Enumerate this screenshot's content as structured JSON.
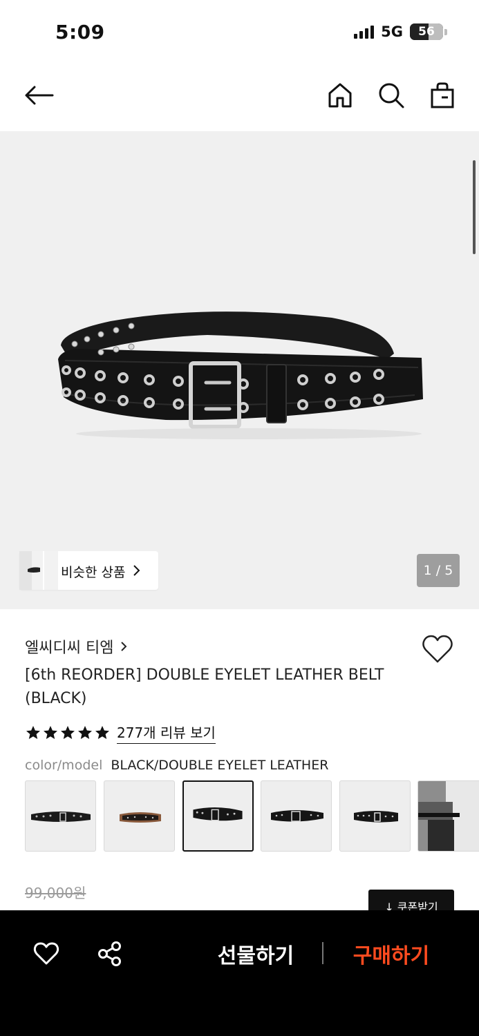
{
  "status_bar": {
    "time": "5:09",
    "network": "5G",
    "battery_percent": "56"
  },
  "nav": {
    "back_icon": "arrow-left-icon",
    "home_icon": "home-icon",
    "search_icon": "search-icon",
    "cart_icon": "shopping-bag-icon"
  },
  "gallery": {
    "similar_label": "비슷한 상품",
    "page_indicator": "1 / 5"
  },
  "product": {
    "brand": "엘씨디씨 티엠",
    "title": "[6th REORDER] DOUBLE EYELET LEATHER BELT (BLACK)",
    "rating_stars": 5,
    "review_link": "277개 리뷰 보기",
    "option_label": "color/model",
    "option_value": "BLACK/DOUBLE EYELET LEATHER",
    "variants": [
      "black-belt-1",
      "tan-belt",
      "black-belt-selected",
      "black-belt-3",
      "black-belt-4",
      "model-photo"
    ],
    "selected_variant_index": 2,
    "original_price": "99,000원",
    "coupon_label": "↓ 쿠폰받기"
  },
  "bottom_bar": {
    "gift_label": "선물하기",
    "buy_label": "구매하기",
    "accent_color": "#ff4b1f"
  }
}
